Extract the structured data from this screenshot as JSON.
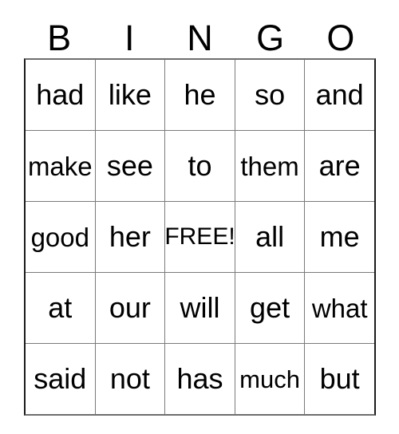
{
  "card": {
    "title": "BINGO",
    "headers": [
      "B",
      "I",
      "N",
      "G",
      "O"
    ],
    "rows": [
      {
        "cells": [
          {
            "text": "had",
            "free": false,
            "fit": "normal"
          },
          {
            "text": "like",
            "free": false,
            "fit": "normal"
          },
          {
            "text": "he",
            "free": false,
            "fit": "normal"
          },
          {
            "text": "so",
            "free": false,
            "fit": "normal"
          },
          {
            "text": "and",
            "free": false,
            "fit": "normal"
          }
        ]
      },
      {
        "cells": [
          {
            "text": "make",
            "free": false,
            "fit": "tight"
          },
          {
            "text": "see",
            "free": false,
            "fit": "normal"
          },
          {
            "text": "to",
            "free": false,
            "fit": "normal"
          },
          {
            "text": "them",
            "free": false,
            "fit": "tight"
          },
          {
            "text": "are",
            "free": false,
            "fit": "normal"
          }
        ]
      },
      {
        "cells": [
          {
            "text": "good",
            "free": false,
            "fit": "tight"
          },
          {
            "text": "her",
            "free": false,
            "fit": "normal"
          },
          {
            "text": "FREE!",
            "free": true,
            "fit": "free"
          },
          {
            "text": "all",
            "free": false,
            "fit": "normal"
          },
          {
            "text": "me",
            "free": false,
            "fit": "normal"
          }
        ]
      },
      {
        "cells": [
          {
            "text": "at",
            "free": false,
            "fit": "normal"
          },
          {
            "text": "our",
            "free": false,
            "fit": "normal"
          },
          {
            "text": "will",
            "free": false,
            "fit": "normal"
          },
          {
            "text": "get",
            "free": false,
            "fit": "normal"
          },
          {
            "text": "what",
            "free": false,
            "fit": "tight"
          }
        ]
      },
      {
        "cells": [
          {
            "text": "said",
            "free": false,
            "fit": "normal"
          },
          {
            "text": "not",
            "free": false,
            "fit": "normal"
          },
          {
            "text": "has",
            "free": false,
            "fit": "normal"
          },
          {
            "text": "much",
            "free": false,
            "fit": "small"
          },
          {
            "text": "but",
            "free": false,
            "fit": "normal"
          }
        ]
      }
    ]
  },
  "colors": {
    "text": "#000000",
    "background": "#ffffff",
    "grid_line": "#7a7a7a",
    "grid_border": "#1a1a1a"
  }
}
